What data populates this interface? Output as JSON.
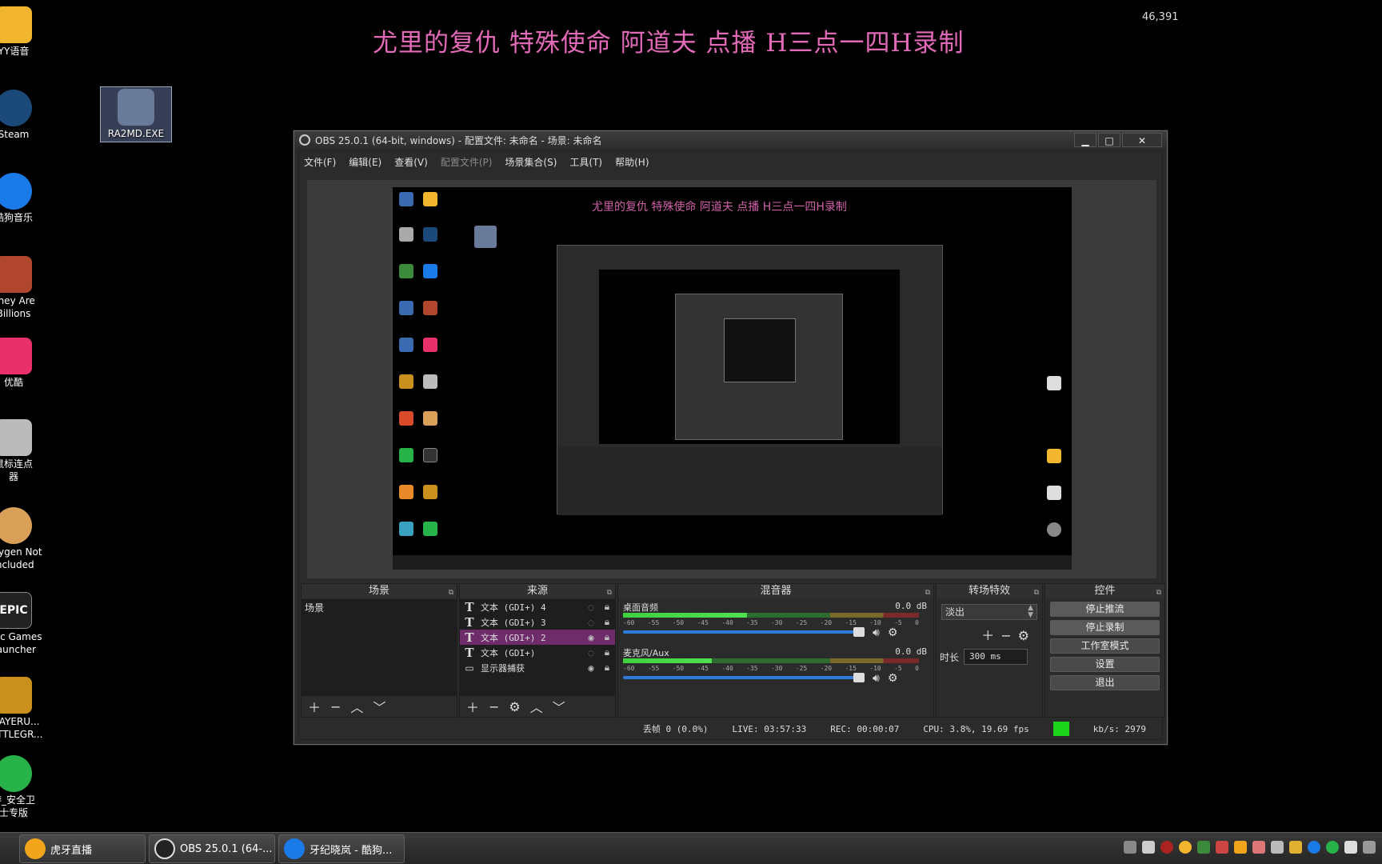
{
  "overlay": {
    "title": "尤里的复仇 特殊使命  阿道夫 点播  H三点一四H录制",
    "count": "46,391"
  },
  "desktop_icons": [
    {
      "label": "YY语音",
      "color": "#f2b62e"
    },
    {
      "label": "Steam",
      "color": "#1b4a7a"
    },
    {
      "label": "酷狗音乐",
      "color": "#1a7ae8"
    },
    {
      "label": "They Are",
      "label2": "Billions",
      "color": "#b0462e"
    },
    {
      "label": "优酷",
      "color": "#e8306a"
    },
    {
      "label": "鼠标连点",
      "label2": "器",
      "color": "#bbbbbb"
    },
    {
      "label": "Oxygen Not",
      "label2": "Included",
      "color": "#d9a05a"
    },
    {
      "label": "Epic Games",
      "label2": "Launcher",
      "color": "#222222"
    },
    {
      "label": "PLAYERU...",
      "label2": "BATTLEGR...",
      "color": "#c9901e"
    },
    {
      "label": "游_安全卫",
      "label2": "士专版",
      "color": "#27b34a"
    },
    {
      "label": "RA2MD.EXE",
      "color": "#6a7b9a"
    }
  ],
  "obs": {
    "title": "OBS 25.0.1 (64-bit, windows) - 配置文件: 未命名 - 场景: 未命名",
    "window_controls": {
      "minimize": "▁",
      "maximize": "□",
      "close": "✕"
    },
    "menu": [
      {
        "label": "文件(F)",
        "enabled": true
      },
      {
        "label": "编辑(E)",
        "enabled": true
      },
      {
        "label": "查看(V)",
        "enabled": true
      },
      {
        "label": "配置文件(P)",
        "enabled": false
      },
      {
        "label": "场景集合(S)",
        "enabled": true
      },
      {
        "label": "工具(T)",
        "enabled": true
      },
      {
        "label": "帮助(H)",
        "enabled": true
      }
    ],
    "preview": {
      "title": "尤里的复仇 特殊使命  阿道夫 点播  H三点一四H录制"
    },
    "scenes": {
      "title": "场景",
      "items": [
        "场景"
      ]
    },
    "sources": {
      "title": "来源",
      "items": [
        {
          "name": "文本 (GDI+) 4",
          "visible": false,
          "selected": false,
          "icon": "text-icon"
        },
        {
          "name": "文本 (GDI+) 3",
          "visible": false,
          "selected": false,
          "icon": "text-icon"
        },
        {
          "name": "文本 (GDI+) 2",
          "visible": true,
          "selected": true,
          "icon": "text-icon"
        },
        {
          "name": "文本 (GDI+)",
          "visible": false,
          "selected": false,
          "icon": "text-icon"
        },
        {
          "name": "显示器捕获",
          "visible": true,
          "selected": false,
          "icon": "monitor-icon"
        }
      ]
    },
    "mixer": {
      "title": "混音器",
      "tracks": [
        {
          "name": "桌面音频",
          "db": "0.0 dB",
          "level": 0.42
        },
        {
          "name": "麦克风/Aux",
          "db": "0.0 dB",
          "level": 0.3
        }
      ],
      "scale": [
        "-60",
        "-55",
        "-50",
        "-45",
        "-40",
        "-35",
        "-30",
        "-25",
        "-20",
        "-15",
        "-10",
        "-5",
        "0"
      ]
    },
    "transitions": {
      "title": "转场特效",
      "selected": "淡出",
      "duration_label": "时长",
      "duration_value": "300 ms"
    },
    "controls": {
      "title": "控件",
      "buttons": [
        "停止推流",
        "停止录制",
        "工作室模式",
        "设置",
        "退出"
      ]
    },
    "status": {
      "dropped": "丢帧 0 (0.0%)",
      "live": "LIVE: 03:57:33",
      "rec": "REC: 00:00:07",
      "cpu": "CPU: 3.8%, 19.69 fps",
      "kbps": "kb/s: 2979",
      "indicator_color": "#1bd41b"
    }
  },
  "taskbar": {
    "tasks": [
      {
        "label": "虎牙直播",
        "color": "#f2a51a"
      },
      {
        "label": "OBS 25.0.1 (64-...",
        "color": "#222222"
      },
      {
        "label": "牙纪晓岚 - 酷狗...",
        "color": "#1a7ae8"
      }
    ]
  }
}
